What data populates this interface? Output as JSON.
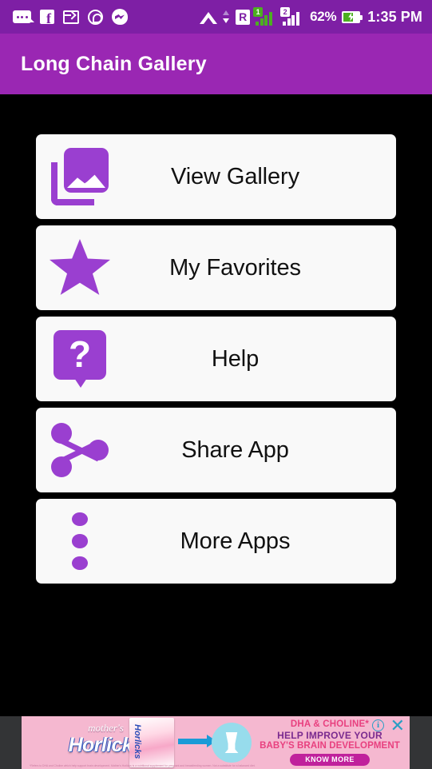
{
  "status_bar": {
    "icons": [
      "chat-bubble-icon",
      "facebook-icon",
      "screen-cast-icon",
      "whatsapp-icon",
      "messenger-icon"
    ],
    "wifi": "wifi-icon",
    "roaming": "R",
    "sim1_badge": "1",
    "sim2_badge": "2",
    "battery_percent": "62%",
    "battery_state": "charging",
    "time": "1:35 PM"
  },
  "app_bar": {
    "title": "Long Chain Gallery",
    "background": "#9a27b3"
  },
  "theme": {
    "status_bar_bg": "#7e1fa5",
    "accent_purple": "#9a3fd0",
    "screen_bg": "#000000",
    "card_bg": "#f9f9f9"
  },
  "menu": {
    "items": [
      {
        "label": "View Gallery",
        "icon": "gallery-icon"
      },
      {
        "label": "My Favorites",
        "icon": "star-icon"
      },
      {
        "label": "Help",
        "icon": "help-question-icon"
      },
      {
        "label": "Share App",
        "icon": "share-icon"
      },
      {
        "label": "More Apps",
        "icon": "more-vertical-dots-icon"
      }
    ]
  },
  "ad": {
    "brand_small": "mother's",
    "brand_main": "Horlicks",
    "pack_label": "Horlicks",
    "line1": "DHA & CHOLINE*",
    "line2": "HELP IMPROVE YOUR",
    "line3": "BABY'S BRAIN DEVELOPMENT",
    "cta": "KNOW MORE",
    "info_label": "i",
    "close_label": "✕",
    "fine_print": "*Refers to DHA and Choline which help support brain development. Mother's Horlicks is a nutritional supplement for pregnant and breastfeeding women. Not a substitute for a balanced diet."
  }
}
